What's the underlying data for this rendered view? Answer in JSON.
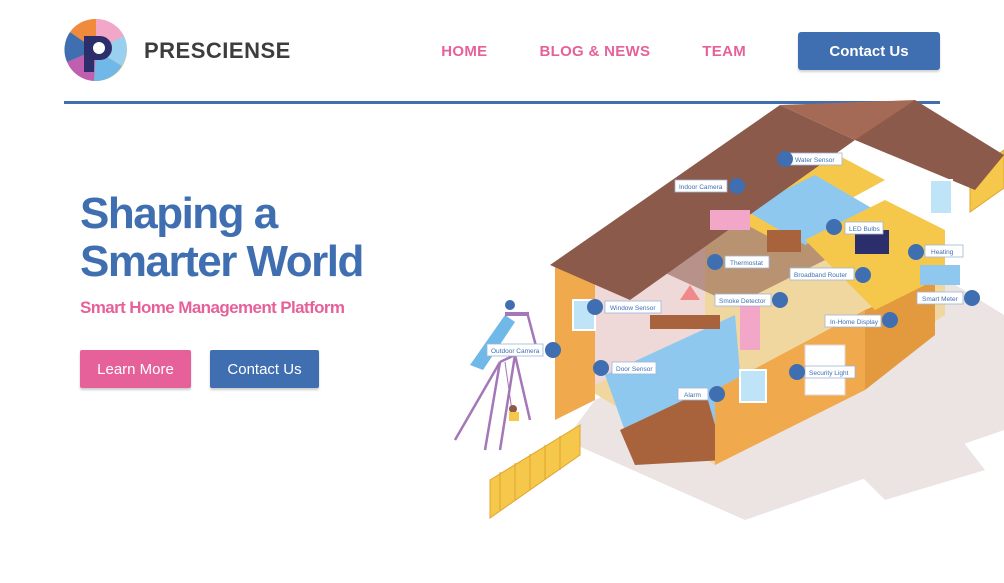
{
  "header": {
    "brand": "PRESCIENSE",
    "nav": [
      {
        "label": "HOME"
      },
      {
        "label": "BLOG & NEWS"
      },
      {
        "label": "TEAM"
      }
    ],
    "cta_label": "Contact Us"
  },
  "hero": {
    "title_line1": "Shaping a",
    "title_bold": "Smarter",
    "title_rest": " World",
    "subtitle": "Smart Home Management Platform",
    "learn_more": "Learn More",
    "contact_us": "Contact Us"
  },
  "illustration": {
    "labels": [
      "Water Sensor",
      "Indoor Camera",
      "LED Bulbs",
      "Heating",
      "Thermostat",
      "Broadband Router",
      "Smart Meter",
      "Window Sensor",
      "Smoke Detector",
      "In-Home Display",
      "Outdoor Camera",
      "Door Sensor",
      "Security Light",
      "Alarm"
    ]
  },
  "colors": {
    "brand_blue": "#3f6fb1",
    "brand_pink": "#e6619a",
    "roof_brown": "#8b5a4a",
    "wall_yellow": "#f5c84c",
    "wall_orange": "#f0a94c"
  }
}
